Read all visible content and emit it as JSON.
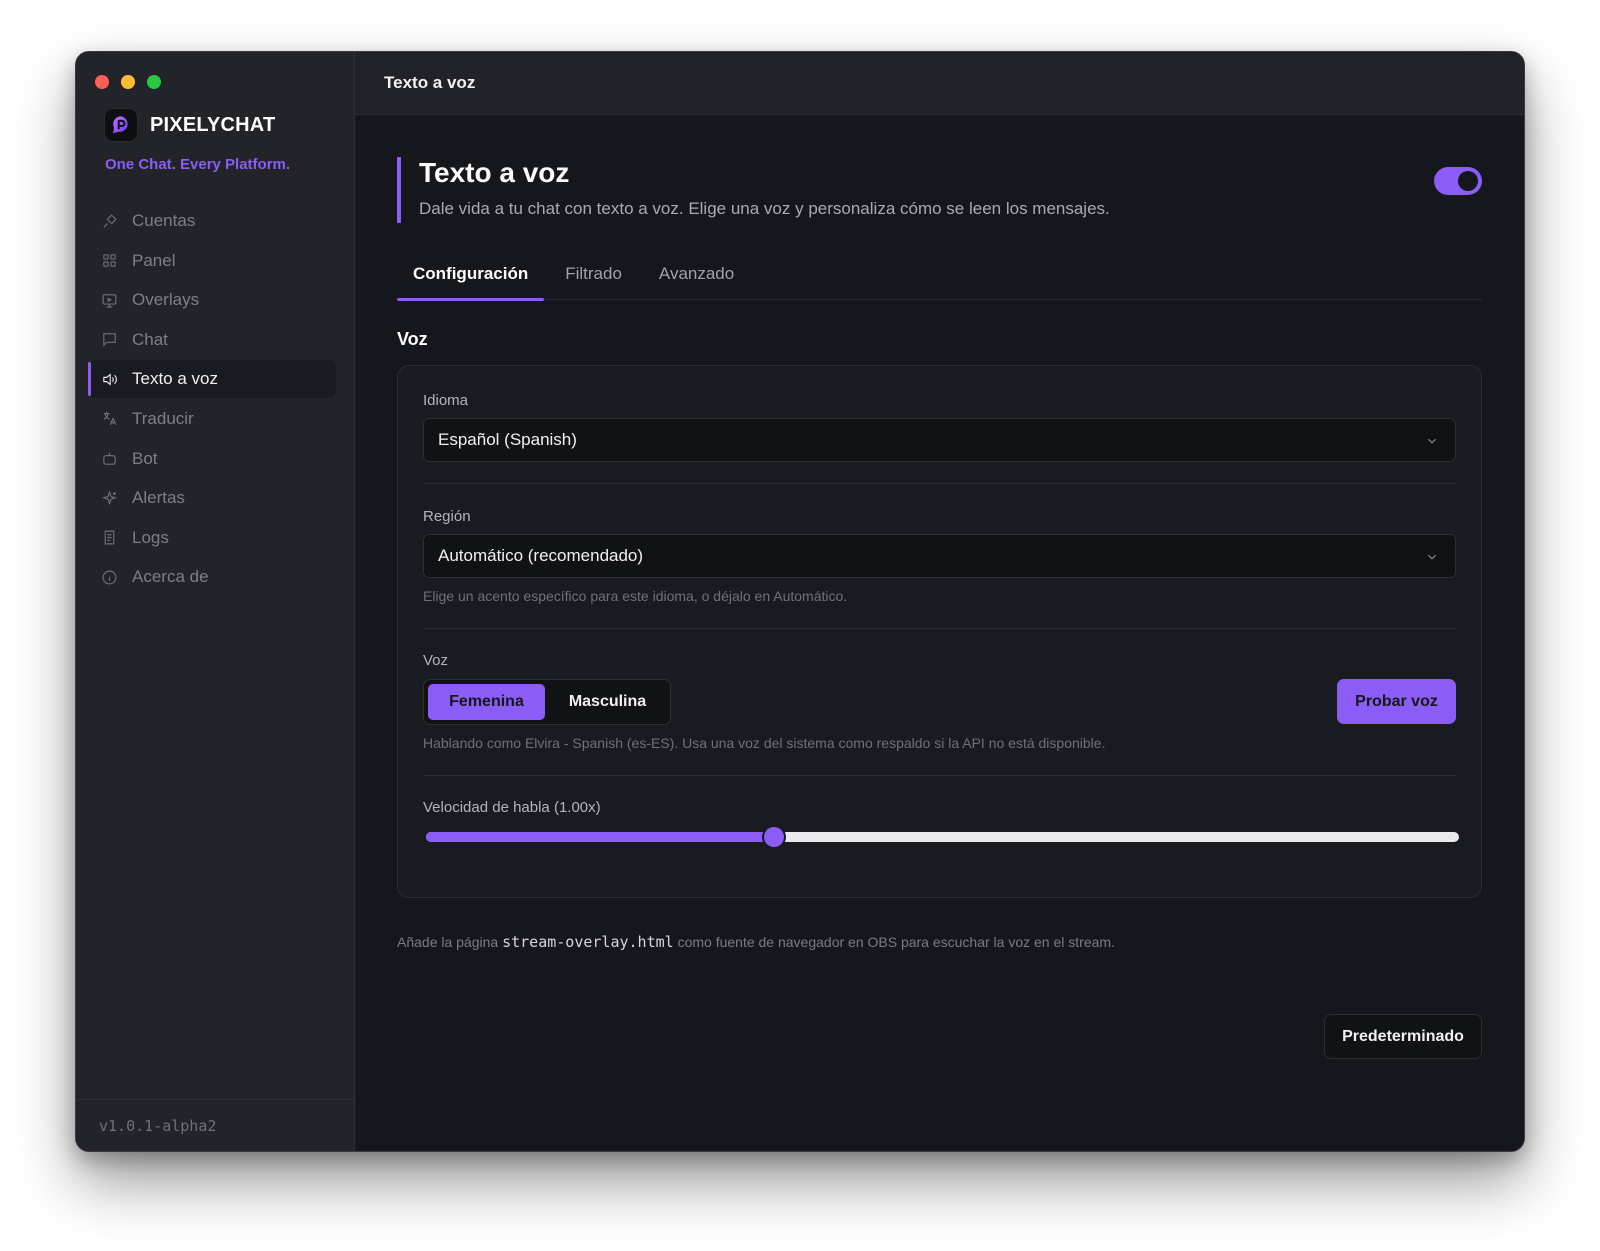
{
  "window": {
    "title": "Texto a voz"
  },
  "brand": {
    "name": "PIXELYCHAT",
    "tagline": "One Chat. Every Platform."
  },
  "sidebar": {
    "items": [
      {
        "label": "Cuentas",
        "icon": "plug-icon"
      },
      {
        "label": "Panel",
        "icon": "grid-icon"
      },
      {
        "label": "Overlays",
        "icon": "monitor-icon"
      },
      {
        "label": "Chat",
        "icon": "chat-bubble-icon"
      },
      {
        "label": "Texto a voz",
        "icon": "speaker-icon",
        "active": true
      },
      {
        "label": "Traducir",
        "icon": "translate-icon"
      },
      {
        "label": "Bot",
        "icon": "robot-icon"
      },
      {
        "label": "Alertas",
        "icon": "sparkles-icon"
      },
      {
        "label": "Logs",
        "icon": "logs-icon"
      },
      {
        "label": "Acerca de",
        "icon": "info-icon"
      }
    ],
    "version": "v1.0.1-alpha2"
  },
  "page": {
    "title": "Texto a voz",
    "description": "Dale vida a tu chat con texto a voz. Elige una voz y personaliza cómo se leen los mensajes.",
    "enabled": true
  },
  "tabs": [
    {
      "label": "Configuración",
      "active": true
    },
    {
      "label": "Filtrado"
    },
    {
      "label": "Avanzado"
    }
  ],
  "voice_section": {
    "title": "Voz",
    "language": {
      "label": "Idioma",
      "value": "Español (Spanish)"
    },
    "region": {
      "label": "Región",
      "value": "Automático (recomendado)",
      "help": "Elige un acento específico para este idioma, o déjalo en Automático."
    },
    "voice": {
      "label": "Voz",
      "options": [
        "Femenina",
        "Masculina"
      ],
      "selected": "Femenina",
      "test_button": "Probar voz",
      "help": "Hablando como Elvira - Spanish (es-ES). Usa una voz del sistema como respaldo si la API no está disponible."
    },
    "speed": {
      "label": "Velocidad de habla (1.00x)",
      "value": 1.0,
      "fraction": 0.337
    }
  },
  "footnote": {
    "prefix": "Añade la página",
    "code": "stream-overlay.html",
    "suffix": "como fuente de navegador en OBS para escuchar la voz en el stream."
  },
  "reset_button": "Predeterminado",
  "colors": {
    "accent": "#8b5cf6",
    "background": "#16171c",
    "sidebar": "#232429"
  }
}
